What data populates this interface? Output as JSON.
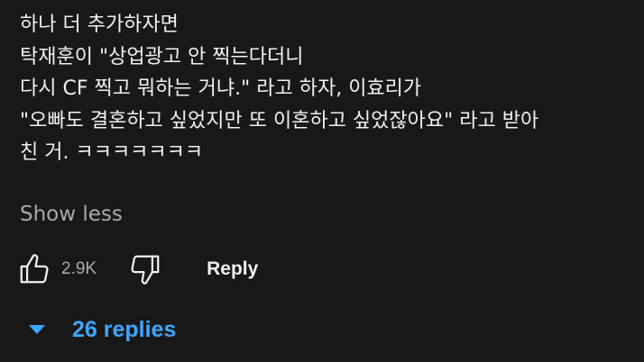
{
  "comment": {
    "lines": [
      "하나 더 추가하자면",
      "탁재훈이 \"상업광고 안 찍는다더니",
      "다시 CF 찍고 뭐하는 거냐.\" 라고 하자, 이효리가",
      "\"오빠도 결혼하고 싶었지만 또 이혼하고 싶었잖아요\" 라고 받아",
      "친 거. ㅋㅋㅋㅋㅋㅋㅋ"
    ],
    "show_less_label": "Show less"
  },
  "actions": {
    "like_icon": "thumbs-up-icon",
    "like_count": "2.9K",
    "dislike_icon": "thumbs-down-icon",
    "reply_label": "Reply"
  },
  "replies": {
    "toggle_icon": "caret-down-icon",
    "label": "26 replies"
  },
  "colors": {
    "background": "#181818",
    "text": "#f1f1f1",
    "muted": "#aaaaaa",
    "accent": "#3ea6ff"
  }
}
